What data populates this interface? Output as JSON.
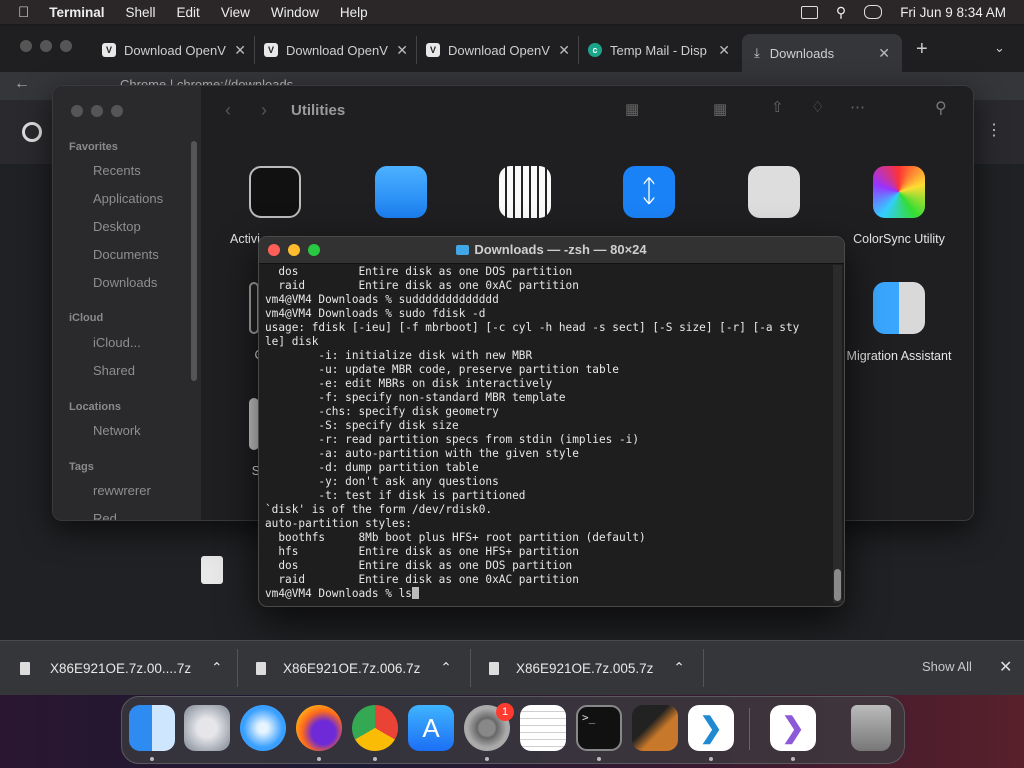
{
  "menubar": {
    "app": "Terminal",
    "items": [
      "Shell",
      "Edit",
      "View",
      "Window",
      "Help"
    ],
    "datetime": "Fri Jun 9  8:34 AM"
  },
  "chrome": {
    "tabs": [
      {
        "label": "Download OpenV"
      },
      {
        "label": "Download OpenV"
      },
      {
        "label": "Download OpenV"
      },
      {
        "label": "Temp Mail - Disp"
      },
      {
        "label": "Downloads"
      }
    ],
    "address": "Chrome  |  chrome://downloads"
  },
  "finder": {
    "title": "Utilities",
    "sidebar": {
      "favorites_header": "Favorites",
      "favorites": [
        "Recents",
        "Applications",
        "Desktop",
        "Documents",
        "Downloads"
      ],
      "icloud_header": "iCloud",
      "icloud": [
        "iCloud...",
        "Shared"
      ],
      "locations_header": "Locations",
      "locations": [
        "Network"
      ],
      "tags_header": "Tags",
      "tags": [
        "rewwrerer",
        "Red"
      ]
    },
    "icons": [
      {
        "label": "Activi"
      },
      {
        "label": "ColorSync Utility"
      },
      {
        "label": "C"
      },
      {
        "label": "Migration Assistant"
      },
      {
        "label": "Sc"
      }
    ]
  },
  "terminal": {
    "title": "Downloads — -zsh — 80×24",
    "lines": [
      "  dos         Entire disk as one DOS partition",
      "  raid        Entire disk as one 0xAC partition",
      "vm4@VM4 Downloads % suddddddddddddd",
      "vm4@VM4 Downloads % sudo fdisk -d",
      "usage: fdisk [-ieu] [-f mbrboot] [-c cyl -h head -s sect] [-S size] [-r] [-a sty",
      "le] disk",
      "        -i: initialize disk with new MBR",
      "        -u: update MBR code, preserve partition table",
      "        -e: edit MBRs on disk interactively",
      "        -f: specify non-standard MBR template",
      "        -chs: specify disk geometry",
      "        -S: specify disk size",
      "        -r: read partition specs from stdin (implies -i)",
      "        -a: auto-partition with the given style",
      "        -d: dump partition table",
      "        -y: don't ask any questions",
      "        -t: test if disk is partitioned",
      "`disk' is of the form /dev/rdisk0.",
      "auto-partition styles:",
      "  boothfs     8Mb boot plus HFS+ root partition (default)",
      "  hfs         Entire disk as one HFS+ partition",
      "  dos         Entire disk as one DOS partition",
      "  raid        Entire disk as one 0xAC partition"
    ],
    "prompt": "vm4@VM4 Downloads % ls"
  },
  "downloads": {
    "items": [
      {
        "name": "X86E921OE.7z.00....7z"
      },
      {
        "name": "X86E921OE.7z.006.7z"
      },
      {
        "name": "X86E921OE.7z.005.7z"
      }
    ],
    "show_all": "Show All"
  },
  "dock": {
    "apps": [
      "finder-icon",
      "launchpad-icon",
      "safari-icon",
      "firefox-icon",
      "chrome-icon",
      "app-store-icon",
      "system-settings-icon",
      "textedit-icon",
      "terminal-icon",
      "garageband-icon",
      "vscode-icon",
      "visual-studio-icon",
      "trash-icon"
    ],
    "settings_badge": "1"
  },
  "colors": {
    "terminal_bg": "#1e1e1e",
    "menubar": "#2b2628",
    "shelf": "#35363a",
    "accent": "#0a84ff"
  }
}
